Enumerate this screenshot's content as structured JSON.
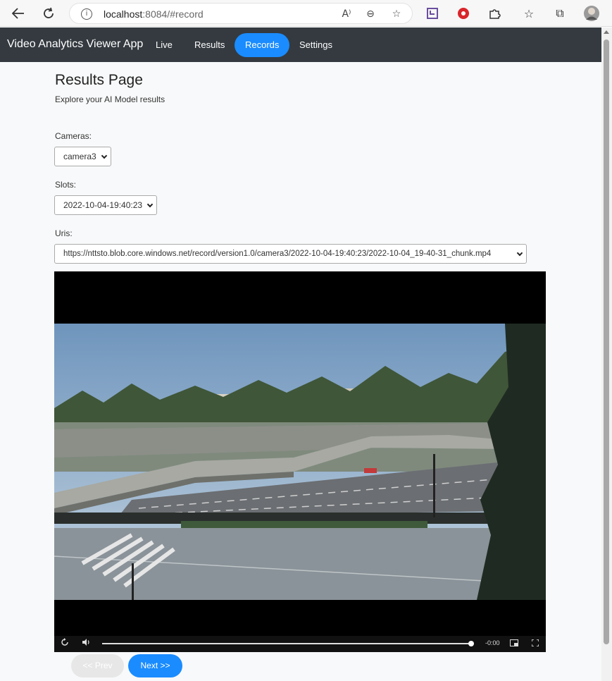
{
  "browser": {
    "url_host": "localhost",
    "url_path": ":8084/#record",
    "info_glyph": "i",
    "read_aloud_glyph": "A⁾",
    "zoom_glyph": "⊖",
    "favorite_glyph": "☆",
    "collections_glyph": "⧉",
    "extensions_glyph": "✦"
  },
  "navbar": {
    "brand": "Video Analytics Viewer App",
    "links": [
      {
        "label": "Live"
      },
      {
        "label": "Results"
      },
      {
        "label": "Records",
        "active": true
      },
      {
        "label": "Settings"
      }
    ]
  },
  "page": {
    "title": "Results Page",
    "subtitle": "Explore your AI Model results",
    "cameras_label": "Cameras:",
    "cameras_value": "camera3",
    "slots_label": "Slots:",
    "slots_value": "2022-10-04-19:40:23",
    "uris_label": "Uris:",
    "uris_value": "https://nttsto.blob.core.windows.net/record/version1.0/camera3/2022-10-04-19:40:23/2022-10-04_19-40-31_chunk.mp4"
  },
  "video": {
    "time_remaining": "-0:00",
    "progress": 1.0
  },
  "buttons": {
    "prev": "<< Prev",
    "next": "Next >>"
  },
  "colors": {
    "navbar": "#343a40",
    "accent": "#1a8cff",
    "page_bg": "#f8f9fa"
  }
}
